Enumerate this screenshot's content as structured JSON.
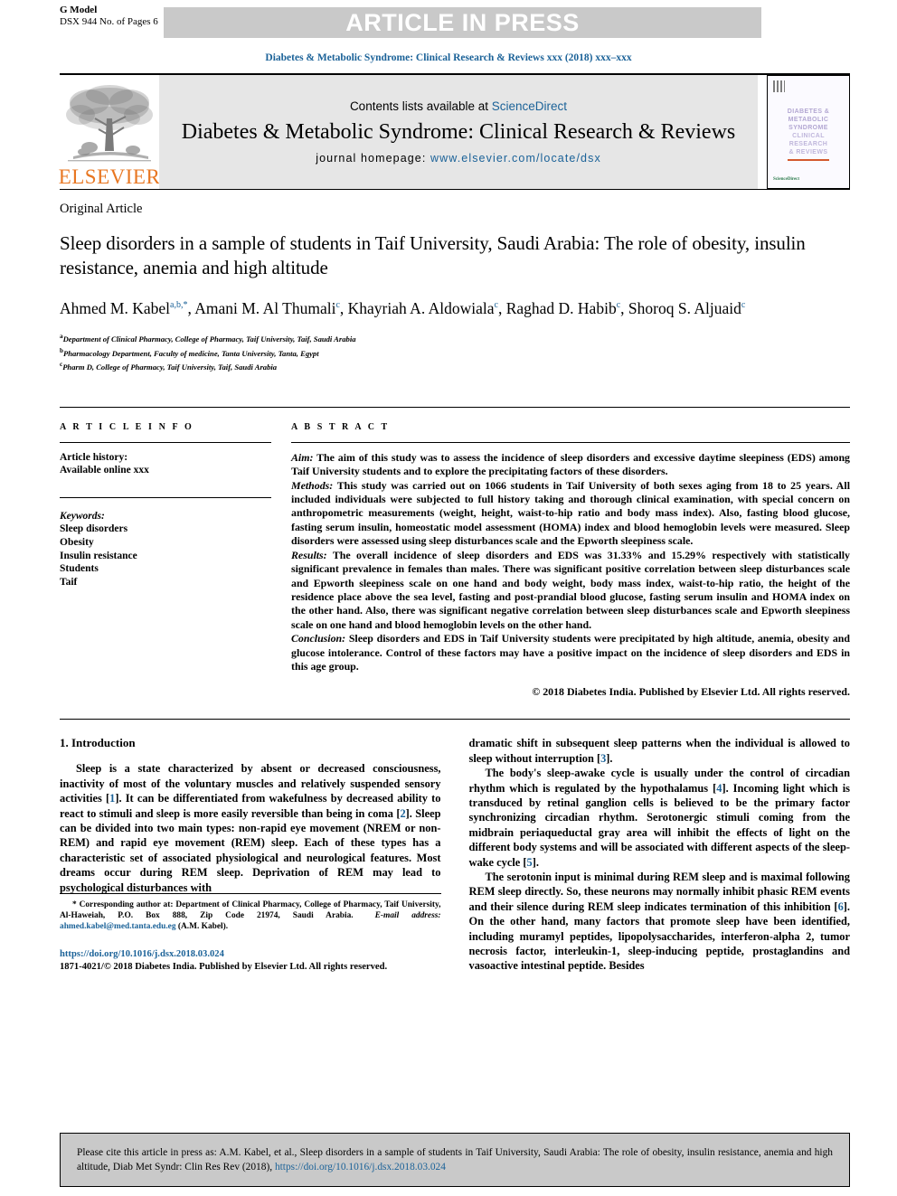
{
  "header": {
    "g_model": "G Model",
    "doc_id": "DSX 944 No. of Pages 6",
    "press_banner": "ARTICLE IN PRESS",
    "journal_line": "Diabetes & Metabolic Syndrome: Clinical Research & Reviews xxx (2018) xxx–xxx"
  },
  "masthead": {
    "contents_prefix": "Contents lists available at ",
    "sciencedirect": "ScienceDirect",
    "journal_title": "Diabetes & Metabolic Syndrome: Clinical Research & Reviews",
    "homepage_label": "journal homepage: ",
    "homepage_url": "www.elsevier.com/locate/dsx",
    "publisher": "ELSEVIER",
    "cover": {
      "line1": "DIABETES &",
      "line2": "METABOLIC",
      "line3": "SYNDROME",
      "line4": "CLINICAL",
      "line5": "RESEARCH",
      "line6": "& REVIEWS",
      "footer": "ScienceDirect"
    }
  },
  "article": {
    "type": "Original Article",
    "title": "Sleep disorders in a sample of students in Taif University, Saudi Arabia: The role of obesity, insulin resistance, anemia and high altitude",
    "authors_html": "Ahmed M. Kabel<sup>a,b,*</sup>, Amani M. Al Thumali<sup>c</sup>, Khayriah A. Aldowiala<sup>c</sup>, Raghad D. Habib<sup>c</sup>, Shoroq S. Aljuaid<sup>c</sup>",
    "affiliations": [
      {
        "mark": "a",
        "text": "Department of Clinical Pharmacy, College of Pharmacy, Taif University, Taif, Saudi Arabia"
      },
      {
        "mark": "b",
        "text": "Pharmacology Department, Faculty of medicine, Tanta University, Tanta, Egypt"
      },
      {
        "mark": "c",
        "text": "Pharm D, College of Pharmacy, Taif University, Taif, Saudi Arabia"
      }
    ]
  },
  "article_info": {
    "heading": "A R T I C L E   I N F O",
    "history_label": "Article history:",
    "history_value": "Available online xxx",
    "keywords_label": "Keywords:",
    "keywords": [
      "Sleep disorders",
      "Obesity",
      "Insulin resistance",
      "Students",
      "Taif"
    ]
  },
  "abstract": {
    "heading": "A B S T R A C T",
    "aim_label": "Aim:",
    "aim_text": " The aim of this study was to assess the incidence of sleep disorders and excessive daytime sleepiness (EDS) among Taif University students and to explore the precipitating factors of these disorders.",
    "methods_label": "Methods:",
    "methods_text": " This study was carried out on 1066 students in Taif University of both sexes aging from 18 to 25 years. All included individuals were subjected to full history taking and thorough clinical examination, with special concern on anthropometric measurements (weight, height, waist-to-hip ratio and body mass index). Also, fasting blood glucose, fasting serum insulin, homeostatic model assessment (HOMA) index and blood hemoglobin levels were measured. Sleep disorders were assessed using sleep disturbances scale and the Epworth sleepiness scale.",
    "results_label": "Results:",
    "results_text": " The overall incidence of sleep disorders and EDS was 31.33% and 15.29% respectively with statistically significant prevalence in females than males. There was significant positive correlation between sleep disturbances scale and Epworth sleepiness scale on one hand and body weight, body mass index, waist-to-hip ratio, the height of the residence place above the sea level, fasting and post-prandial blood glucose, fasting serum insulin and HOMA index on the other hand. Also, there was significant negative correlation between sleep disturbances scale and Epworth sleepiness scale on one hand and blood hemoglobin levels on the other hand.",
    "conclusion_label": "Conclusion:",
    "conclusion_text": " Sleep disorders and EDS in Taif University students were precipitated by high altitude, anemia, obesity and glucose intolerance. Control of these factors may have a positive impact on the incidence of sleep disorders and EDS in this age group.",
    "copyright": "© 2018 Diabetes India. Published by Elsevier Ltd. All rights reserved."
  },
  "introduction": {
    "heading": "1. Introduction",
    "left_p1_a": "Sleep is a state characterized by absent or decreased consciousness, inactivity of most of the voluntary muscles and relatively suspended sensory activities [",
    "left_p1_ref1": "1",
    "left_p1_b": "]. It can be differentiated from wakefulness by decreased ability to react to stimuli and sleep is more easily reversible than being in coma [",
    "left_p1_ref2": "2",
    "left_p1_c": "]. Sleep can be divided into two main types: non-rapid eye movement (NREM or non-REM) and rapid eye movement (REM) sleep. Each of these types has a characteristic set of associated physiological and neurological features. Most dreams occur during REM sleep. Deprivation of REM may lead to psychological disturbances with",
    "right_p1_a": "dramatic shift in subsequent sleep patterns when the individual is allowed to sleep without interruption [",
    "right_p1_ref": "3",
    "right_p1_b": "].",
    "right_p2_a": "The body's sleep-awake cycle is usually under the control of circadian rhythm which is regulated by the hypothalamus [",
    "right_p2_ref1": "4",
    "right_p2_b": "]. Incoming light which is transduced by retinal ganglion cells is believed to be the primary factor synchronizing circadian rhythm. Serotonergic stimuli coming from the midbrain periaqueductal gray area will inhibit the effects of light on the different body systems and will be associated with different aspects of the sleep-wake cycle [",
    "right_p2_ref2": "5",
    "right_p2_c": "].",
    "right_p3_a": "The serotonin input is minimal during REM sleep and is maximal following REM sleep directly. So, these neurons may normally inhibit phasic REM events and their silence during REM sleep indicates termination of this inhibition [",
    "right_p3_ref": "6",
    "right_p3_b": "]. On the other hand, many factors that promote sleep have been identified, including muramyl peptides, lipopolysaccharides, interferon-alpha 2, tumor necrosis factor, interleukin-1, sleep-inducing peptide, prostaglandins and vasoactive intestinal peptide. Besides"
  },
  "footnote": {
    "corresponding": "* Corresponding author at: Department of Clinical Pharmacy, College of Pharmacy, Taif University, Al-Haweiah, P.O. Box 888, Zip Code 21974, Saudi Arabia.",
    "email_label": "E-mail address:",
    "email": "ahmed.kabel@med.tanta.edu.eg",
    "email_suffix": " (A.M. Kabel).",
    "doi": "https://doi.org/10.1016/j.dsx.2018.03.024",
    "issn_line": "1871-4021/© 2018 Diabetes India. Published by Elsevier Ltd. All rights reserved."
  },
  "cite_box": {
    "text": "Please cite this article in press as: A.M. Kabel, et al., Sleep disorders in a sample of students in Taif University, Saudi Arabia: The role of obesity, insulin resistance, anemia and high altitude, Diab Met Syndr: Clin Res Rev (2018), ",
    "link": "https://doi.org/10.1016/j.dsx.2018.03.024"
  },
  "colors": {
    "link_blue": "#1b6298",
    "banner_gray": "#c9c9c9",
    "masthead_gray": "#e6e6e6",
    "elsevier_orange": "#e87722"
  }
}
